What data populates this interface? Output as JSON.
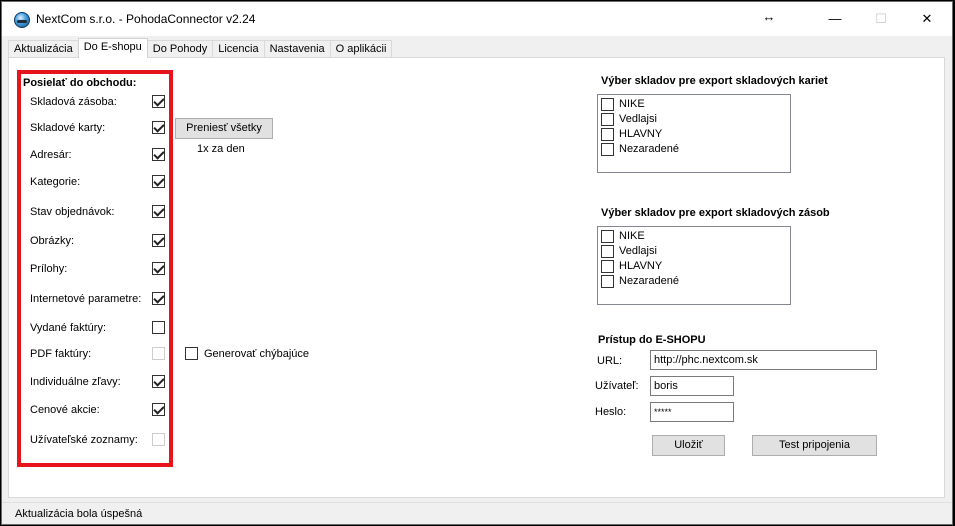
{
  "window": {
    "title": "NextCom s.r.o. - PohodaConnector v2.24",
    "resize_glyph": "↔",
    "minimize_glyph": "—",
    "maximize_glyph": "☐",
    "close_glyph": "✕"
  },
  "tabs": [
    {
      "label": "Aktualizácia",
      "active": false
    },
    {
      "label": "Do E-shopu",
      "active": true
    },
    {
      "label": "Do Pohody",
      "active": false
    },
    {
      "label": "Licencia",
      "active": false
    },
    {
      "label": "Nastavenia",
      "active": false
    },
    {
      "label": "O aplikácii",
      "active": false
    }
  ],
  "send_section": {
    "title": "Posielať do obchodu:",
    "items": [
      {
        "label": "Skladová zásoba:",
        "checked": true,
        "enabled": true
      },
      {
        "label": "Skladové karty:",
        "checked": true,
        "enabled": true
      },
      {
        "label": "Adresár:",
        "checked": true,
        "enabled": true
      },
      {
        "label": "Kategorie:",
        "checked": true,
        "enabled": true
      },
      {
        "label": "Stav objednávok:",
        "checked": true,
        "enabled": true
      },
      {
        "label": "Obrázky:",
        "checked": true,
        "enabled": true
      },
      {
        "label": "Prílohy:",
        "checked": true,
        "enabled": true
      },
      {
        "label": "Internetové parametre:",
        "checked": true,
        "enabled": true
      },
      {
        "label": "Vydané faktúry:",
        "checked": false,
        "enabled": true
      },
      {
        "label": "PDF faktúry:",
        "checked": false,
        "enabled": false
      },
      {
        "label": "Individuálne zľavy:",
        "checked": true,
        "enabled": true
      },
      {
        "label": "Cenové akcie:",
        "checked": true,
        "enabled": true
      },
      {
        "label": "Užívateľské zoznamy:",
        "checked": false,
        "enabled": false
      }
    ],
    "transfer_button": "Preniesť všetky",
    "frequency_text": "1x za den",
    "generate_missing_label": "Generovať chýbajúce",
    "generate_missing_checked": false
  },
  "card_warehouses": {
    "title": "Výber skladov pre export skladových kariet",
    "items": [
      {
        "label": "NIKE",
        "checked": false
      },
      {
        "label": "Vedlajsi",
        "checked": false
      },
      {
        "label": "HLAVNY",
        "checked": false
      },
      {
        "label": "Nezaradené",
        "checked": false
      }
    ]
  },
  "stock_warehouses": {
    "title": "Výber skladov pre export skladových zásob",
    "items": [
      {
        "label": "NIKE",
        "checked": false
      },
      {
        "label": "Vedlajsi",
        "checked": false
      },
      {
        "label": "HLAVNY",
        "checked": false
      },
      {
        "label": "Nezaradené",
        "checked": false
      }
    ]
  },
  "eshop_access": {
    "title": "Prístup do E-SHOPU",
    "url_label": "URL:",
    "url_value": "http://phc.nextcom.sk",
    "user_label": "Užívateľ:",
    "user_value": "boris",
    "password_label": "Heslo:",
    "password_value": "*****",
    "save_button": "Uložiť",
    "test_button": "Test pripojenia"
  },
  "status": {
    "text": "Aktualizácia bola úspešná"
  }
}
